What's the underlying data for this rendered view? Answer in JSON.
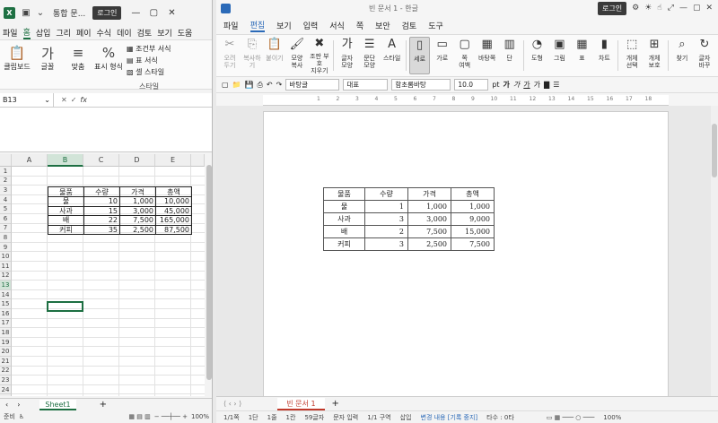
{
  "excel": {
    "title": "통합 문...",
    "login_label": "로그인",
    "tabs": [
      "파일",
      "홈",
      "삽입",
      "그리",
      "페이",
      "수식",
      "데이",
      "검토",
      "보기",
      "도움"
    ],
    "ribbon": {
      "clipboard": "클립보드",
      "font": "글꼴",
      "align": "맞춤",
      "number": "표시 형식",
      "cond_format": "조건부 서식",
      "table_format": "표 서식",
      "cell_style": "셀 스타일",
      "styles_caption": "스타일"
    },
    "namebox": "B13",
    "fx": "fx",
    "columns": [
      "A",
      "B",
      "C",
      "D",
      "E"
    ],
    "rows": [
      "1",
      "2",
      "3",
      "4",
      "5",
      "6",
      "7",
      "8",
      "9",
      "10",
      "11",
      "12",
      "13",
      "14",
      "15",
      "16",
      "17",
      "18",
      "19",
      "20",
      "21",
      "22",
      "23",
      "24",
      "25"
    ],
    "table": {
      "headers": [
        "물품",
        "수량",
        "가격",
        "총액"
      ],
      "rows": [
        [
          "물",
          "10",
          "1,000",
          "10,000"
        ],
        [
          "사과",
          "15",
          "3,000",
          "45,000"
        ],
        [
          "배",
          "22",
          "7,500",
          "165,000"
        ],
        [
          "커피",
          "35",
          "2,500",
          "87,500"
        ]
      ]
    },
    "sheet_tab": "Sheet1",
    "status_left": "준비",
    "zoom": "100%"
  },
  "hwp": {
    "title": "빈 문서 1 - 한글",
    "login_label": "로그인",
    "menu": [
      "파일",
      "편집",
      "보기",
      "입력",
      "서식",
      "쪽",
      "보안",
      "검토",
      "도구"
    ],
    "ribbon": [
      {
        "label": "오려\n두기",
        "icon": "✂",
        "dim": true
      },
      {
        "label": "복사하기",
        "icon": "⎘",
        "dim": true
      },
      {
        "label": "붙이기",
        "icon": "📋",
        "dim": true
      },
      {
        "label": "모양\n복사",
        "icon": "🖌",
        "dim": false
      },
      {
        "label": "조판 부호\n지우기",
        "icon": "✖",
        "dim": false
      },
      {
        "label": "글자\n모양",
        "icon": "가",
        "dim": false
      },
      {
        "label": "문단\n모양",
        "icon": "☰",
        "dim": false
      },
      {
        "label": "스타일",
        "icon": "A",
        "dim": false
      },
      {
        "label": "세로",
        "icon": "▯",
        "dim": false,
        "pressed": true
      },
      {
        "label": "가로",
        "icon": "▭",
        "dim": false
      },
      {
        "label": "쪽\n여백",
        "icon": "▢",
        "dim": false
      },
      {
        "label": "바탕쪽",
        "icon": "▦",
        "dim": false
      },
      {
        "label": "단",
        "icon": "▥",
        "dim": false
      },
      {
        "label": "도형",
        "icon": "◔",
        "dim": false
      },
      {
        "label": "그림",
        "icon": "▣",
        "dim": false
      },
      {
        "label": "표",
        "icon": "▦",
        "dim": false
      },
      {
        "label": "차트",
        "icon": "▮",
        "dim": false
      },
      {
        "label": "개체\n선택",
        "icon": "⬚",
        "dim": false
      },
      {
        "label": "개체\n보호",
        "icon": "⊞",
        "dim": false
      },
      {
        "label": "찾기",
        "icon": "⌕",
        "dim": false
      },
      {
        "label": "글자\n바꾸",
        "icon": "↻",
        "dim": false
      }
    ],
    "toolbar": {
      "style": "바탕글",
      "lang": "대표",
      "font": "함초롬바탕",
      "size": "10.0",
      "unit": "pt"
    },
    "ruler_marks": [
      "1",
      "2",
      "3",
      "4",
      "5",
      "6",
      "7",
      "8",
      "9",
      "10",
      "11",
      "12",
      "13",
      "14",
      "15",
      "16",
      "17",
      "18"
    ],
    "table": {
      "headers": [
        "물품",
        "수량",
        "가격",
        "총액"
      ],
      "rows": [
        [
          "물",
          "1",
          "1,000",
          "1,000"
        ],
        [
          "사과",
          "3",
          "3,000",
          "9,000"
        ],
        [
          "배",
          "2",
          "7,500",
          "15,000"
        ],
        [
          "커피",
          "3",
          "2,500",
          "7,500"
        ]
      ]
    },
    "doc_tab": "빈 문서 1",
    "status": [
      "1/1쪽",
      "1단",
      "1줄",
      "1칸",
      "59글자",
      "문자 입력",
      "1/1 구역",
      "삽입"
    ],
    "status_change": "변경 내용 [기록 중지]",
    "status_trail": "타수 : 0타",
    "zoom": "100%"
  }
}
